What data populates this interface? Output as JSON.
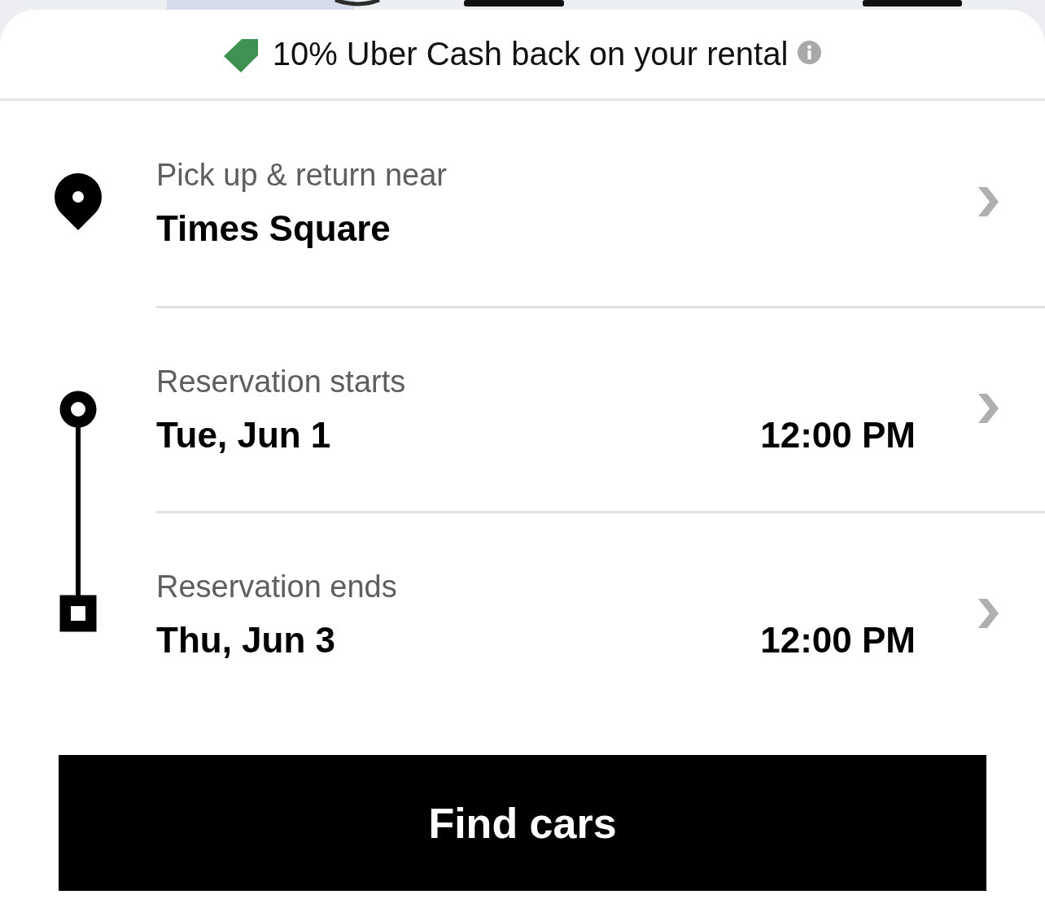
{
  "promo": {
    "text": "10% Uber Cash back on your rental"
  },
  "rows": [
    {
      "kind": "location",
      "label": "Pick up & return near",
      "value": "Times Square"
    },
    {
      "kind": "start",
      "label": "Reservation starts",
      "date": "Tue, Jun 1",
      "time": "12:00 PM"
    },
    {
      "kind": "end",
      "label": "Reservation ends",
      "date": "Thu, Jun 3",
      "time": "12:00 PM"
    }
  ],
  "button": {
    "label": "Find cars"
  }
}
